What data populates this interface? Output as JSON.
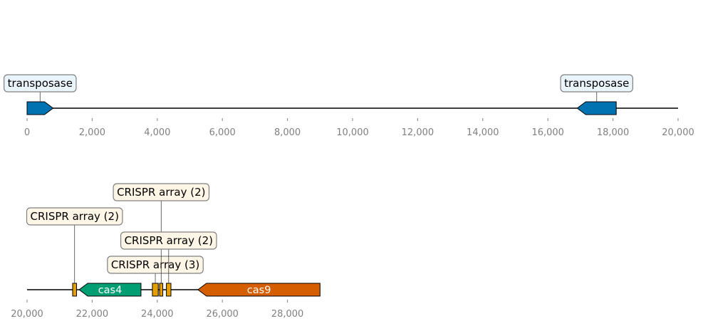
{
  "colors": {
    "backbone": "#000000",
    "tick_text": "#808080",
    "transposase": "#0072B2",
    "cas4": "#009E73",
    "cas9": "#D55E00",
    "crispr": "#E69F00",
    "transposase_label_bg": "#eaf4fb",
    "crispr_label_bg": "#fdf6e6",
    "label_border": "#808080"
  },
  "tracks": [
    {
      "range": [
        0,
        20000
      ],
      "ticks": [
        {
          "value": 0,
          "label": "0"
        },
        {
          "value": 2000,
          "label": "2,000"
        },
        {
          "value": 4000,
          "label": "4,000"
        },
        {
          "value": 6000,
          "label": "6,000"
        },
        {
          "value": 8000,
          "label": "8,000"
        },
        {
          "value": 10000,
          "label": "10,000"
        },
        {
          "value": 12000,
          "label": "12,000"
        },
        {
          "value": 14000,
          "label": "14,000"
        },
        {
          "value": 16000,
          "label": "16,000"
        },
        {
          "value": 18000,
          "label": "18,000"
        },
        {
          "value": 20000,
          "label": "20,000"
        }
      ],
      "features": [
        {
          "start": 0,
          "end": 800,
          "strand": 1,
          "color": "transposase",
          "text": "",
          "label": "transposase",
          "label_level": 1
        },
        {
          "start": 16900,
          "end": 18100,
          "strand": -1,
          "color": "transposase",
          "text": "",
          "label": "transposase",
          "label_level": 1
        }
      ]
    },
    {
      "range": [
        20000,
        29000
      ],
      "ticks": [
        {
          "value": 20000,
          "label": "20,000"
        },
        {
          "value": 22000,
          "label": "22,000"
        },
        {
          "value": 24000,
          "label": "24,000"
        },
        {
          "value": 26000,
          "label": "26,000"
        },
        {
          "value": 28000,
          "label": "28,000"
        }
      ],
      "features": [
        {
          "start": 21400,
          "end": 21520,
          "strand": 0,
          "color": "crispr",
          "text": "",
          "label": "CRISPR array (2)",
          "label_level": 3
        },
        {
          "start": 21600,
          "end": 23500,
          "strand": -1,
          "color": "cas4",
          "text": "cas4",
          "label": "",
          "label_level": 0
        },
        {
          "start": 23850,
          "end": 24030,
          "strand": 0,
          "color": "crispr",
          "text": "",
          "label": "CRISPR array (3)",
          "label_level": 1
        },
        {
          "start": 24070,
          "end": 24170,
          "strand": 0,
          "color": "crispr",
          "text": "",
          "label": "CRISPR array (2)",
          "label_level": 4
        },
        {
          "start": 24280,
          "end": 24420,
          "strand": 0,
          "color": "crispr",
          "text": "",
          "label": "CRISPR array (2)",
          "label_level": 2
        },
        {
          "start": 25250,
          "end": 29000,
          "strand": -1,
          "color": "cas9",
          "text": "cas9",
          "label": "",
          "label_level": 0
        }
      ]
    }
  ]
}
